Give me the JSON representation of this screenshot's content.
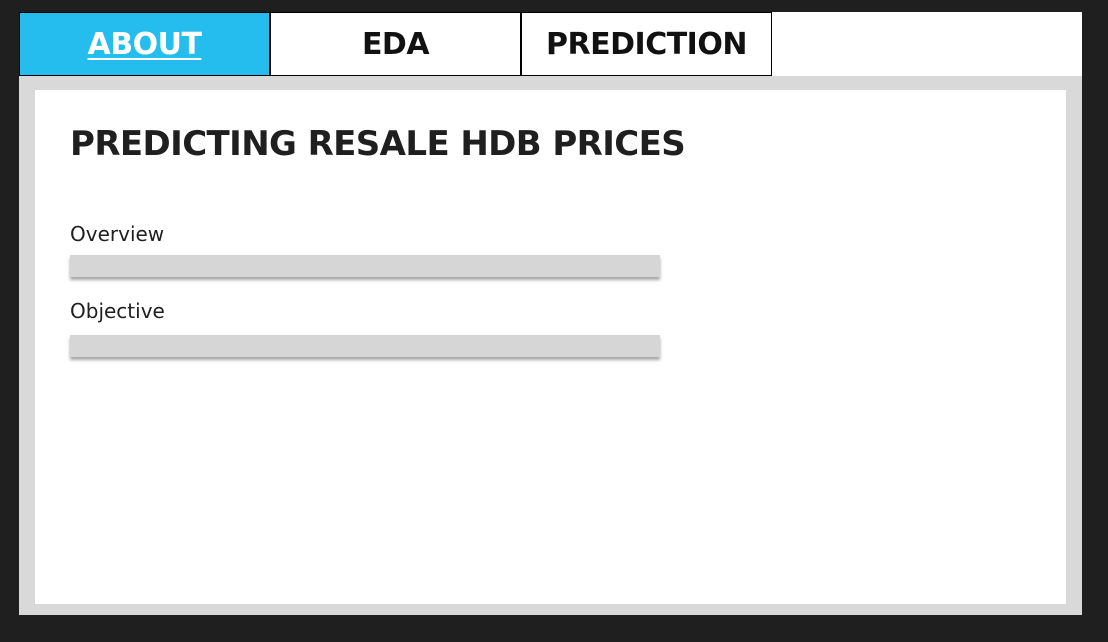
{
  "tabs": [
    {
      "label": "ABOUT",
      "active": true
    },
    {
      "label": "EDA",
      "active": false
    },
    {
      "label": "PREDICTION",
      "active": false
    }
  ],
  "page": {
    "title": "PREDICTING RESALE HDB PRICES"
  },
  "sections": [
    {
      "label": "Overview",
      "expanded": false
    },
    {
      "label": "Objective",
      "expanded": false
    }
  ],
  "colors": {
    "active_tab": "#24bdee",
    "background": "#1f1f1f",
    "frame": "#d9d9d9",
    "collapsible_bar": "#d6d6d6"
  }
}
